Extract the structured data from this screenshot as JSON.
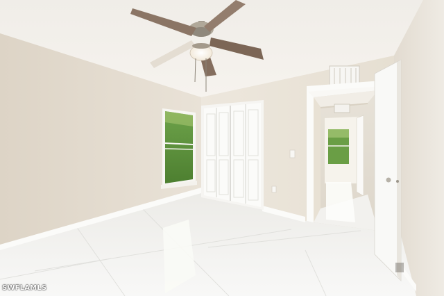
{
  "watermark": "SWFLAMLS",
  "colors": {
    "ceiling": "#f2efea",
    "left_wall": "#e4ddd1",
    "back_wall": "#ece6dc",
    "right_wall": "#ebe6de",
    "floor": "#f3f3f1",
    "baseboard": "#fbfbf9",
    "door_white": "#f8f8f6",
    "fan_blade": "#8a7464",
    "window_greenery": "#5c8f3c"
  },
  "scene_objects": [
    "ceiling-fan",
    "ceiling-light",
    "window",
    "closet-double-door",
    "open-doorway",
    "hallway",
    "open-door",
    "hvac-vent",
    "tile-floor"
  ]
}
